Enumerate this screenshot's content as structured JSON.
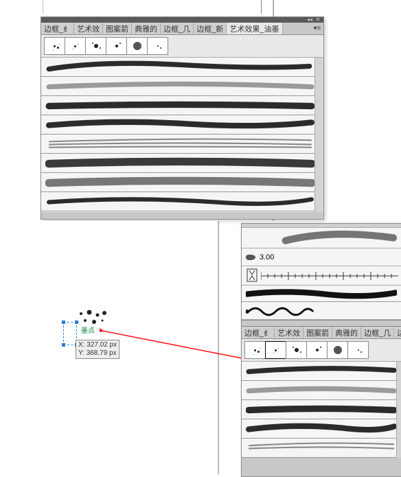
{
  "panel_top": {
    "tabs": [
      {
        "label": "边框_纟"
      },
      {
        "label": "艺术效"
      },
      {
        "label": "图案箭"
      },
      {
        "label": "典雅的"
      },
      {
        "label": "边框_几"
      },
      {
        "label": "边框_新"
      },
      {
        "label": "艺术效果_油墨"
      }
    ],
    "active_tab_index": 6,
    "thumbs": [
      {
        "name": "ink-splat-1"
      },
      {
        "name": "ink-splat-2"
      },
      {
        "name": "ink-splat-3"
      },
      {
        "name": "ink-splat-4"
      },
      {
        "name": "ink-blob"
      },
      {
        "name": "ink-splat-sparse"
      }
    ]
  },
  "panel_right": {
    "stroke_value": "3.00",
    "tabs": [
      {
        "label": "边框_纟"
      },
      {
        "label": "艺术效"
      },
      {
        "label": "图案箭"
      },
      {
        "label": "典雅的"
      },
      {
        "label": "边框_几"
      },
      {
        "label": "边"
      }
    ],
    "selected_thumb_index": 1
  },
  "canvas": {
    "object_label": "墨点",
    "coord_x_label": "X:",
    "coord_x_value": "327.02 px",
    "coord_y_label": "Y:",
    "coord_y_value": "368.79 px"
  }
}
